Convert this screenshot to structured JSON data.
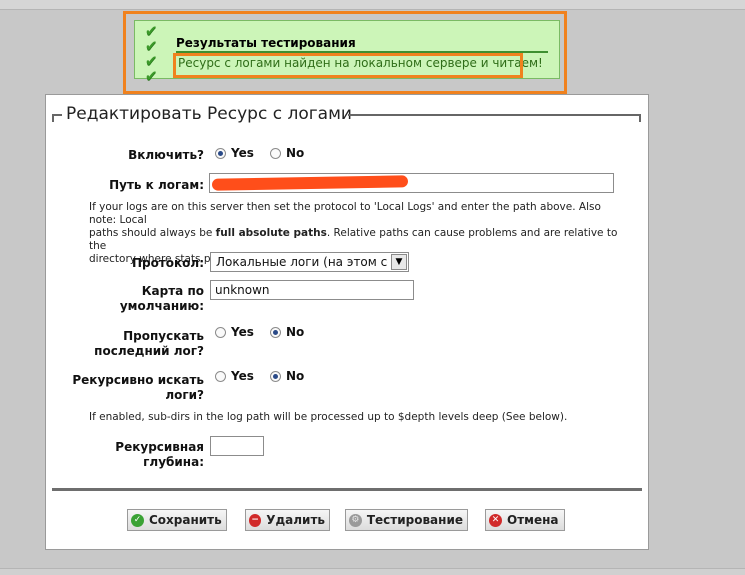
{
  "result": {
    "title": "Результаты тестирования",
    "message": "Ресурс с логами найден на локальном сервере и читаем!"
  },
  "form": {
    "legend": "Редактировать Ресурс с логами",
    "enable": {
      "label": "Включить?",
      "yes": "Yes",
      "no": "No",
      "selected": "Yes"
    },
    "path": {
      "label": "Путь к логам:",
      "value": ""
    },
    "path_help": [
      "If your logs are on this server then set the protocol to 'Local Logs' and enter the path above. Also note: Local",
      "paths should always be ",
      "full absolute paths",
      ". Relative paths can cause problems and are relative to the",
      "directory where stats.pl is run from (not from this website)."
    ],
    "protocol": {
      "label": "Протокол:",
      "value": "Локальные логи (на этом сер"
    },
    "default_map": {
      "label_line1": "Карта по",
      "label_line2": "умолчанию:",
      "value": "unknown"
    },
    "skip_last": {
      "label_line1": "Пропускать",
      "label_line2": "последний лог?",
      "yes": "Yes",
      "no": "No",
      "selected": "No"
    },
    "recursive": {
      "label_line1": "Рекурсивно искать",
      "label_line2": "логи?",
      "yes": "Yes",
      "no": "No",
      "selected": "No"
    },
    "recursive_help": "If enabled, sub-dirs in the log path will be processed up to $depth levels deep (See below).",
    "depth": {
      "label_line1": "Рекурсивная",
      "label_line2": "глубина:",
      "value": ""
    }
  },
  "buttons": {
    "save": "Сохранить",
    "delete": "Удалить",
    "test": "Тестирование",
    "cancel": "Отмена"
  },
  "colors": {
    "highlight": "#f0821e",
    "success_bg": "#ccf5b8",
    "success_text": "#2f6d18"
  },
  "icons": [
    "check-icon",
    "save-icon",
    "delete-icon",
    "gear-icon",
    "cancel-icon"
  ]
}
